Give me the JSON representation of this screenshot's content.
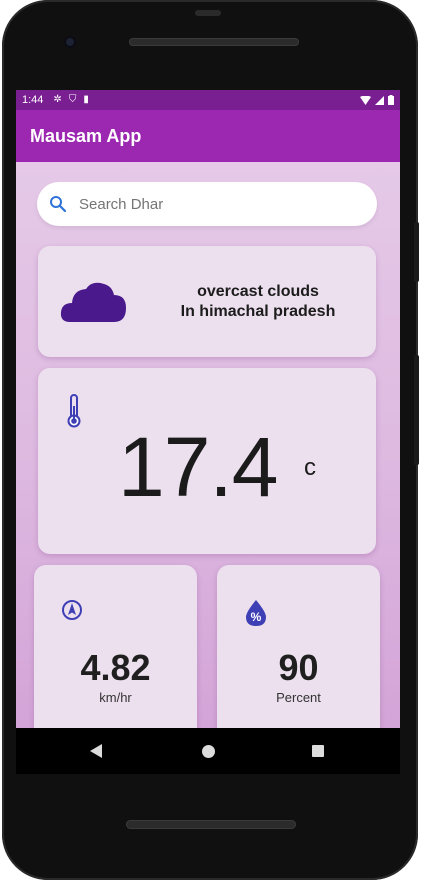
{
  "status_bar": {
    "time": "1:44"
  },
  "app_bar": {
    "title": "Mausam App"
  },
  "search": {
    "placeholder": "Search Dhar",
    "value": ""
  },
  "condition": {
    "description": "overcast clouds",
    "location": "In himachal pradesh"
  },
  "temperature": {
    "value": "17.4",
    "unit": "c"
  },
  "wind": {
    "value": "4.82",
    "unit": "km/hr"
  },
  "humidity": {
    "value": "90",
    "unit": "Percent"
  },
  "colors": {
    "status_bar": "#7a1f92",
    "app_bar": "#9c27b0",
    "icon_accent": "#3f3fb5",
    "cloud": "#4a1a8c"
  },
  "icons": {
    "search": "search-icon",
    "cloud": "cloud-icon",
    "temperature": "thermometer-icon",
    "wind": "compass-icon",
    "humidity": "water-drop-percent-icon"
  }
}
